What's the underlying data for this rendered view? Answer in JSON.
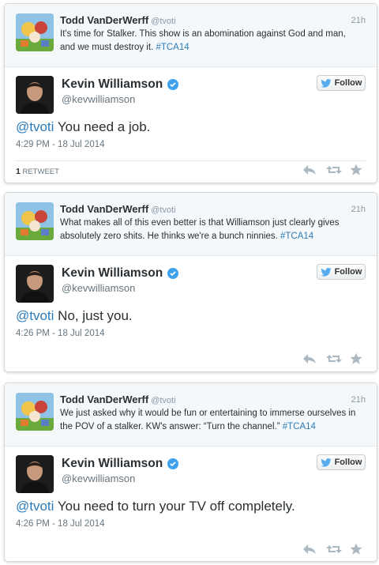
{
  "colors": {
    "link": "#2b7bb9",
    "verified": "#3ea1ec",
    "secondary_text": "#66757f",
    "twitter_blue": "#55acee"
  },
  "tweets": [
    {
      "parent": {
        "name": "Todd VanDerWerff",
        "handle": "@tvoti",
        "time": "21h",
        "text": "It's time for Stalker. This show is an abomination against God and man, and we must destroy it.",
        "hashtag": "#TCA14"
      },
      "author": {
        "name": "Kevin Williamson",
        "handle": "@kevwilliamson",
        "follow_label": "Follow"
      },
      "mention": "@tvoti",
      "text": " You need a job.",
      "date": "4:29 PM - 18 Jul 2014",
      "retweet_count": "1",
      "retweet_label": "RETWEET"
    },
    {
      "parent": {
        "name": "Todd VanDerWerff",
        "handle": "@tvoti",
        "time": "21h",
        "text": "What makes all of this even better is that Williamson just clearly gives absolutely zero shits. He thinks we're a bunch ninnies.",
        "hashtag": "#TCA14"
      },
      "author": {
        "name": "Kevin Williamson",
        "handle": "@kevwilliamson",
        "follow_label": "Follow"
      },
      "mention": "@tvoti",
      "text": " No, just you.",
      "date": "4:26 PM - 18 Jul 2014"
    },
    {
      "parent": {
        "name": "Todd VanDerWerff",
        "handle": "@tvoti",
        "time": "21h",
        "text": "We just asked why it would be fun or entertaining to immerse ourselves in the POV of a stalker. KW's answer: “Turn the channel.”",
        "hashtag": "#TCA14"
      },
      "author": {
        "name": "Kevin Williamson",
        "handle": "@kevwilliamson",
        "follow_label": "Follow"
      },
      "mention": "@tvoti",
      "text": " You need to turn your TV off completely.",
      "date": "4:26 PM - 18 Jul 2014"
    }
  ]
}
